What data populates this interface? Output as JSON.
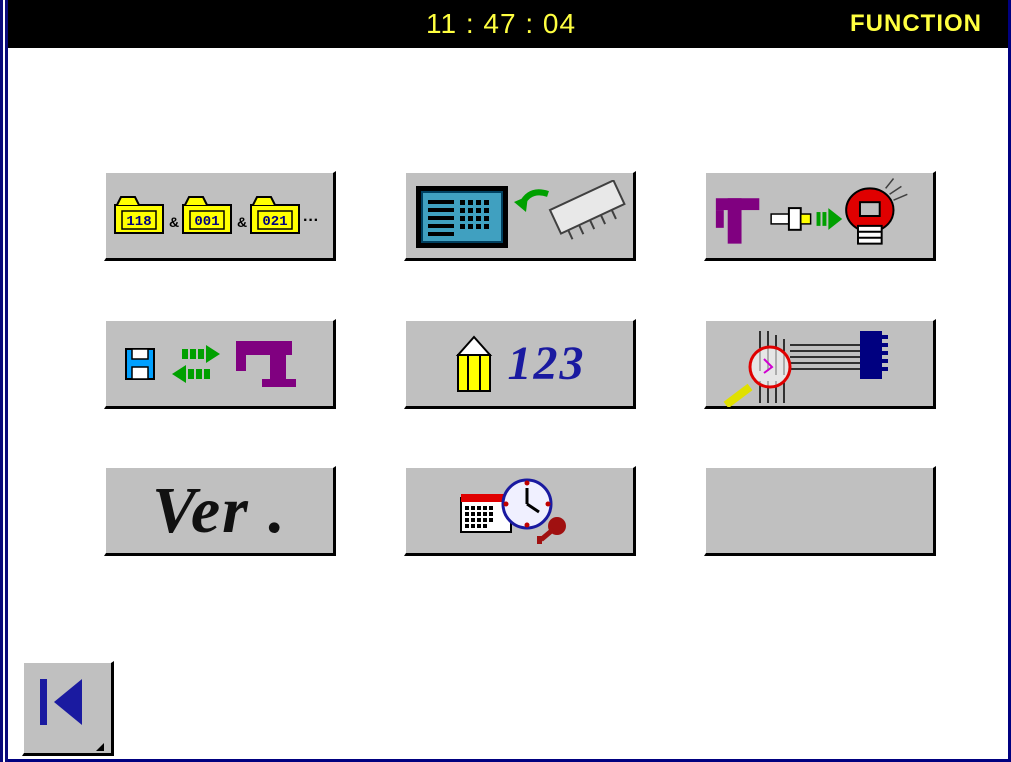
{
  "header": {
    "clock": "11 : 47 : 04",
    "mode": "FUNCTION"
  },
  "buttons": {
    "pattern_select": {
      "folders": [
        "118",
        "001",
        "021"
      ],
      "separator": "&",
      "more": "···"
    },
    "version": {
      "label": "Ver ."
    },
    "counter": {
      "label": "123"
    }
  },
  "colors": {
    "header_bg": "#000000",
    "header_text": "#ffff40",
    "button_face": "#c0c0c0",
    "frame": "#000080",
    "folder": "#ffff00",
    "machine": "#800080",
    "arrow": "#00a000"
  }
}
